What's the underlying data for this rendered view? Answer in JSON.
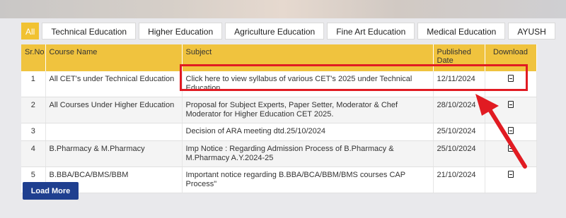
{
  "tabs": [
    {
      "label": "All",
      "active": true
    },
    {
      "label": "Technical Education"
    },
    {
      "label": "Higher Education"
    },
    {
      "label": "Agriculture Education"
    },
    {
      "label": "Fine Art Education"
    },
    {
      "label": "Medical Education"
    },
    {
      "label": "AYUSH"
    }
  ],
  "table": {
    "headers": {
      "sr_no": "Sr.No",
      "course_name": "Course Name",
      "subject": "Subject",
      "published_date": "Published Date",
      "download": "Download"
    },
    "rows": [
      {
        "sr": "1",
        "course": "All CET's under Technical Education",
        "subject": "Click here to view syllabus of various CET's 2025 under Technical Education",
        "date": "12/11/2024",
        "download_icon": "pdf-file-icon"
      },
      {
        "sr": "2",
        "course": "All Courses Under Higher Education",
        "subject": "Proposal for Subject Experts, Paper Setter, Moderator & Chef Moderator for Higher Education CET 2025.",
        "date": "28/10/2024",
        "download_icon": "pdf-file-icon"
      },
      {
        "sr": "3",
        "course": "",
        "subject": "Decision of ARA meeting dtd.25/10/2024",
        "date": "25/10/2024",
        "download_icon": "pdf-file-icon"
      },
      {
        "sr": "4",
        "course": "B.Pharmacy & M.Pharmacy",
        "subject": "Imp Notice : Regarding Admission Process of B.Pharmacy & M.Pharmacy A.Y.2024-25",
        "date": "25/10/2024",
        "download_icon": "pdf-file-icon"
      },
      {
        "sr": "5",
        "course": "B.BBA/BCA/BMS/BBM",
        "subject": "Important notice regarding B.BBA/BCA/BBM/BMS courses CAP Process\"",
        "date": "21/10/2024",
        "download_icon": "pdf-file-icon"
      }
    ]
  },
  "load_more_label": "Load More",
  "colors": {
    "header_bg": "#f0c33e",
    "annotation_red": "#e11b22",
    "button_blue": "#1f3f8f"
  }
}
